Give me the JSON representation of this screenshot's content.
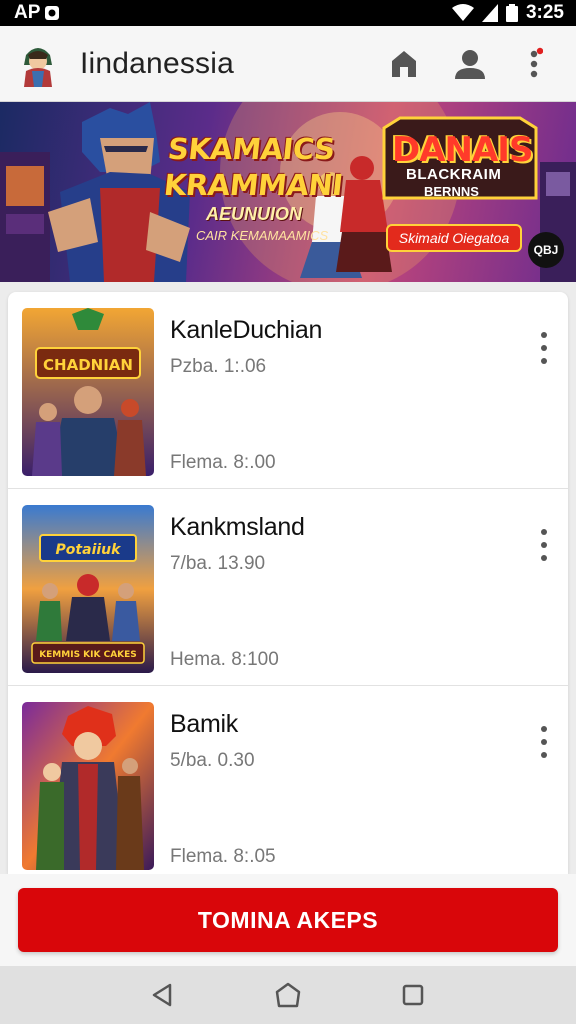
{
  "status_bar": {
    "left_text": "AP",
    "time": "3:25"
  },
  "app_bar": {
    "title": "Iindanessia",
    "icons": [
      "home-icon",
      "profile-icon",
      "more-icon"
    ]
  },
  "banner": {
    "title_line1": "SKAMAICS",
    "title_line2": "KRAMMANI",
    "subtitle": "AEUNUION",
    "caption": "CAIR KEMAMAAMICS",
    "logo_title": "DANAIS",
    "logo_sub1": "BLACKRAIM",
    "logo_sub2": "BERNNS",
    "cta_label": "Skimaid Oiegatoa",
    "badge": "QBJ"
  },
  "games": [
    {
      "name": "KanleDuchian",
      "meta": "Pzba. 1:.06",
      "size": "Flema. 8:.00"
    },
    {
      "name": "Kankmsland",
      "meta": "7/ba. 13.90",
      "size": "Hema. 8:100"
    },
    {
      "name": "Bamik",
      "meta": "5/ba. 0.30",
      "size": "Flema. 8:.05"
    }
  ],
  "thumb_titles": [
    "CHADNIAN",
    "Potaiiuk",
    ""
  ],
  "thumb_captions": [
    "",
    "KEMMIS KIK CAKES",
    ""
  ],
  "cta": {
    "label": "TOMINA AKEPS"
  },
  "colors": {
    "accent": "#d9060a",
    "banner_gold": "#ffd23a"
  }
}
